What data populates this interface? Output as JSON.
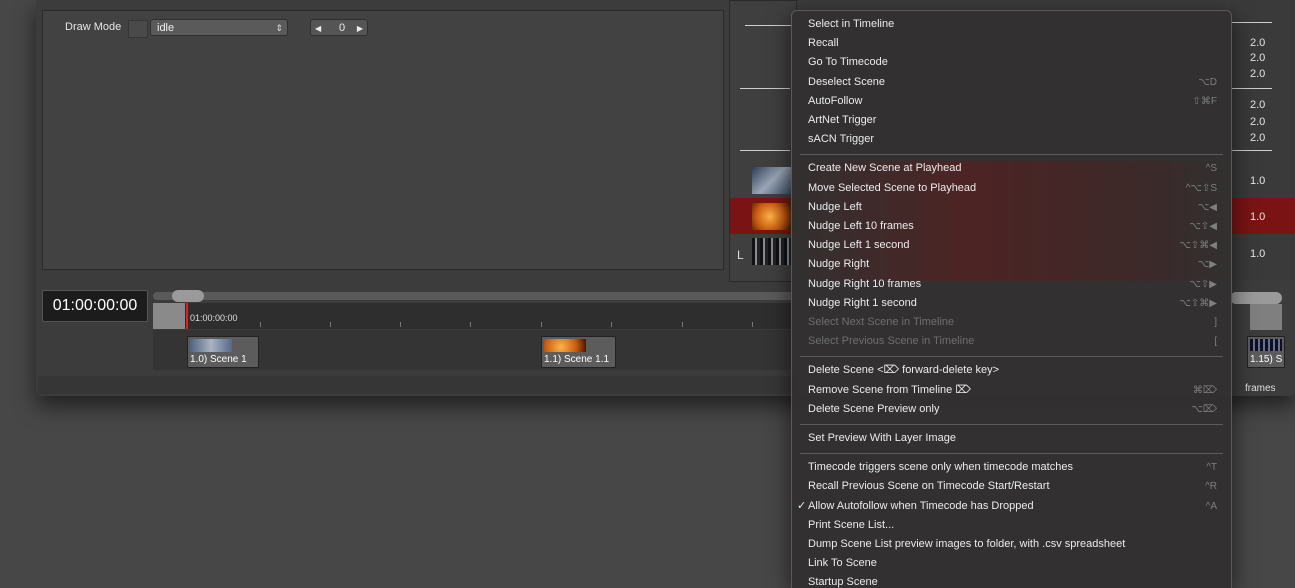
{
  "inspector": {
    "draw_mode_label": "Draw Mode",
    "draw_mode_value": "idle",
    "draw_mode_arrows": "⇕",
    "stepper_value": "0",
    "stepper_left": "◀",
    "stepper_right": "▶"
  },
  "scene_list": {
    "values": [
      "2.0",
      "2.0",
      "2.0",
      "2.0",
      "2.0",
      "2.0",
      "1.0",
      "1.0",
      "1.0"
    ],
    "tree_mark": "L"
  },
  "timeline": {
    "timecode": "01:00:00:00",
    "ruler_start_label": "01:00:00:00",
    "clips": [
      "1.0) Scene 1",
      "1.1) Scene 1.1"
    ],
    "edge_clip_label": "1.15) S",
    "frames_label": "frames"
  },
  "context_menu": {
    "groups": [
      [
        {
          "label": "Select in Timeline",
          "shortcut": "",
          "disabled": false,
          "checked": false
        },
        {
          "label": "Recall",
          "shortcut": "",
          "disabled": false,
          "checked": false
        },
        {
          "label": "Go To Timecode",
          "shortcut": "",
          "disabled": false,
          "checked": false
        },
        {
          "label": "Deselect Scene",
          "shortcut": "⌥D",
          "disabled": false,
          "checked": false
        },
        {
          "label": "AutoFollow",
          "shortcut": "⇧⌘F",
          "disabled": false,
          "checked": false
        },
        {
          "label": "ArtNet Trigger",
          "shortcut": "",
          "disabled": false,
          "checked": false
        },
        {
          "label": "sACN Trigger",
          "shortcut": "",
          "disabled": false,
          "checked": false
        }
      ],
      [
        {
          "label": "Create New Scene at Playhead",
          "shortcut": "^S",
          "disabled": false,
          "checked": false
        },
        {
          "label": "Move Selected Scene to Playhead",
          "shortcut": "^⌥⇧S",
          "disabled": false,
          "checked": false
        },
        {
          "label": "Nudge Left",
          "shortcut": "⌥◀",
          "disabled": false,
          "checked": false
        },
        {
          "label": "Nudge Left 10 frames",
          "shortcut": "⌥⇧◀",
          "disabled": false,
          "checked": false
        },
        {
          "label": "Nudge Left 1 second",
          "shortcut": "⌥⇧⌘◀",
          "disabled": false,
          "checked": false
        },
        {
          "label": "Nudge Right",
          "shortcut": "⌥▶",
          "disabled": false,
          "checked": false
        },
        {
          "label": "Nudge Right 10 frames",
          "shortcut": "⌥⇧▶",
          "disabled": false,
          "checked": false
        },
        {
          "label": "Nudge Right 1 second",
          "shortcut": "⌥⇧⌘▶",
          "disabled": false,
          "checked": false
        },
        {
          "label": "Select Next Scene in Timeline",
          "shortcut": "]",
          "disabled": true,
          "checked": false
        },
        {
          "label": "Select Previous Scene in Timeline",
          "shortcut": "[",
          "disabled": true,
          "checked": false
        }
      ],
      [
        {
          "label": "Delete Scene <⌦ forward-delete key>",
          "shortcut": "",
          "disabled": false,
          "checked": false
        },
        {
          "label": "Remove Scene from Timeline ⌦",
          "shortcut": "⌘⌦",
          "disabled": false,
          "checked": false
        },
        {
          "label": "Delete Scene Preview only",
          "shortcut": "⌥⌦",
          "disabled": false,
          "checked": false
        }
      ],
      [
        {
          "label": "Set Preview With Layer Image",
          "shortcut": "",
          "disabled": false,
          "checked": false
        }
      ],
      [
        {
          "label": "Timecode triggers scene only when timecode matches",
          "shortcut": "^T",
          "disabled": false,
          "checked": false
        },
        {
          "label": "Recall Previous Scene on Timecode Start/Restart",
          "shortcut": "^R",
          "disabled": false,
          "checked": false
        },
        {
          "label": "Allow Autofollow when Timecode has Dropped",
          "shortcut": "^A",
          "disabled": false,
          "checked": true
        },
        {
          "label": "Print Scene List...",
          "shortcut": "",
          "disabled": false,
          "checked": false
        },
        {
          "label": "Dump Scene List preview images to folder, with .csv spreadsheet",
          "shortcut": "",
          "disabled": false,
          "checked": false
        },
        {
          "label": "Link To Scene",
          "shortcut": "",
          "disabled": false,
          "checked": false
        },
        {
          "label": "Startup Scene",
          "shortcut": "",
          "disabled": false,
          "checked": false
        }
      ]
    ],
    "checkmark": "✓"
  }
}
